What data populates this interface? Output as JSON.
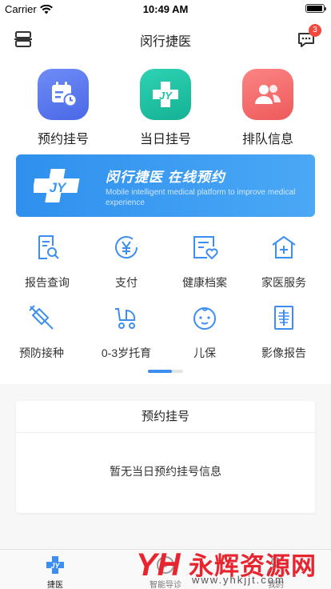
{
  "status_bar": {
    "carrier": "Carrier",
    "time": "10:49 AM"
  },
  "nav": {
    "title": "闵行捷医",
    "message_badge": "3"
  },
  "quick_actions": [
    {
      "label": "预约挂号",
      "icon": "calendar-clock-icon",
      "color": "#5b7cf1"
    },
    {
      "label": "当日挂号",
      "icon": "jy-cross-icon",
      "color": "#1fc3a6"
    },
    {
      "label": "排队信息",
      "icon": "people-icon",
      "color": "#f36b6b"
    }
  ],
  "banner": {
    "title": "闵行捷医  在线预约",
    "subtitle": "Mobile intelligent medical platform to improve medical experience",
    "logo_text": "JY",
    "color": "#3a98f0"
  },
  "services": [
    {
      "label": "报告查询",
      "icon": "report-search-icon"
    },
    {
      "label": "支付",
      "icon": "yuan-coin-icon"
    },
    {
      "label": "健康档案",
      "icon": "health-record-icon"
    },
    {
      "label": "家医服务",
      "icon": "family-doctor-house-icon"
    },
    {
      "label": "预防接种",
      "icon": "syringe-icon"
    },
    {
      "label": "0-3岁托育",
      "icon": "stroller-icon"
    },
    {
      "label": "儿保",
      "icon": "baby-face-icon"
    },
    {
      "label": "影像报告",
      "icon": "xray-icon"
    }
  ],
  "appointment_card": {
    "title": "预约挂号",
    "empty_text": "暂无当日预约挂号信息"
  },
  "tabs": [
    {
      "label": "捷医",
      "icon": "jy-cross-icon",
      "active": true
    },
    {
      "label": "智能导诊",
      "icon": "guide-icon",
      "active": false
    },
    {
      "label": "我的",
      "icon": "profile-icon",
      "active": false
    }
  ],
  "watermark": {
    "logo": "YH",
    "text": "永辉资源网",
    "url": "www.yhkjjt.com"
  },
  "colors": {
    "accent": "#3d8ef1",
    "icon_line": "#3d8ef1",
    "watermark_red": "#e8252f"
  }
}
